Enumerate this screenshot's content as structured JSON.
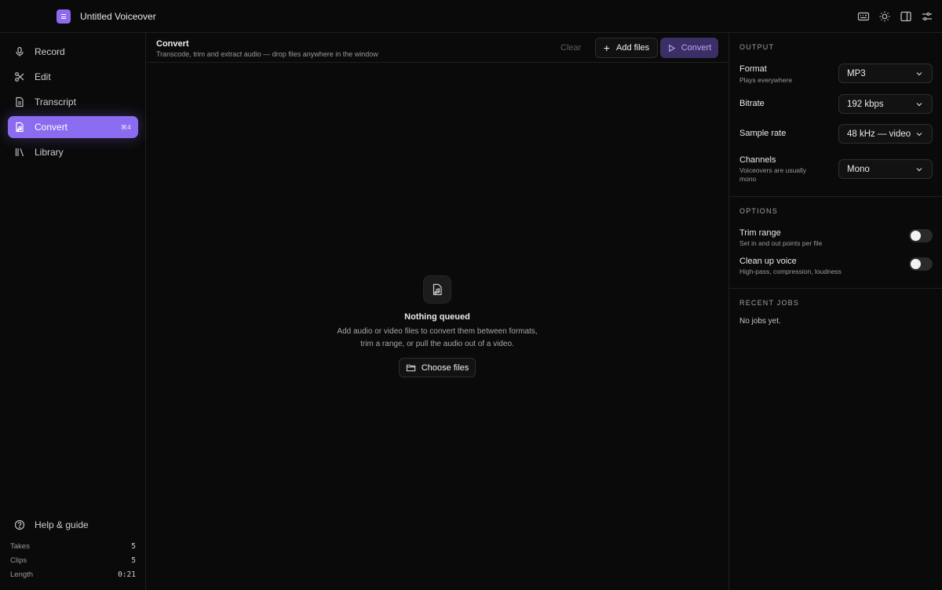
{
  "app": {
    "title": "Untitled Voiceover"
  },
  "titlebar_icons": [
    "keyboard-icon",
    "sun-icon",
    "panel-layout-icon",
    "sliders-icon"
  ],
  "sidebar": {
    "items": [
      {
        "label": "Record",
        "icon": "mic-icon"
      },
      {
        "label": "Edit",
        "icon": "scissors-icon"
      },
      {
        "label": "Transcript",
        "icon": "document-icon"
      },
      {
        "label": "Convert",
        "icon": "file-audio-icon",
        "shortcut": "⌘4",
        "active": true
      },
      {
        "label": "Library",
        "icon": "library-icon"
      }
    ],
    "help": {
      "label": "Help & guide",
      "icon": "help-circle-icon"
    },
    "stats": [
      {
        "label": "Takes",
        "value": "5"
      },
      {
        "label": "Clips",
        "value": "5"
      },
      {
        "label": "Length",
        "value": "0:21"
      }
    ]
  },
  "main": {
    "title": "Convert",
    "subtitle": "Transcode, trim and extract audio — drop files anywhere in the window",
    "clear_label": "Clear",
    "add_files_label": "Add files",
    "convert_label": "Convert",
    "empty": {
      "title": "Nothing queued",
      "description": "Add audio or video files to convert them between formats, trim a range, or pull the audio out of a video.",
      "choose_label": "Choose files"
    }
  },
  "panel": {
    "output_title": "OUTPUT",
    "format": {
      "label": "Format",
      "sub": "Plays everywhere",
      "value": "MP3"
    },
    "bitrate": {
      "label": "Bitrate",
      "value": "192 kbps"
    },
    "sample_rate": {
      "label": "Sample rate",
      "value": "48 kHz — video"
    },
    "channels": {
      "label": "Channels",
      "sub": "Voiceovers are usually mono",
      "value": "Mono"
    },
    "options_title": "OPTIONS",
    "trim": {
      "label": "Trim range",
      "sub": "Set in and out points per file",
      "enabled": false
    },
    "cleanup": {
      "label": "Clean up voice",
      "sub": "High-pass, compression, loudness",
      "enabled": false
    },
    "jobs_title": "RECENT JOBS",
    "no_jobs": "No jobs yet."
  },
  "colors": {
    "accent": "#8b6cf0",
    "background": "#0a0a0a",
    "border": "#1f1f1f"
  }
}
